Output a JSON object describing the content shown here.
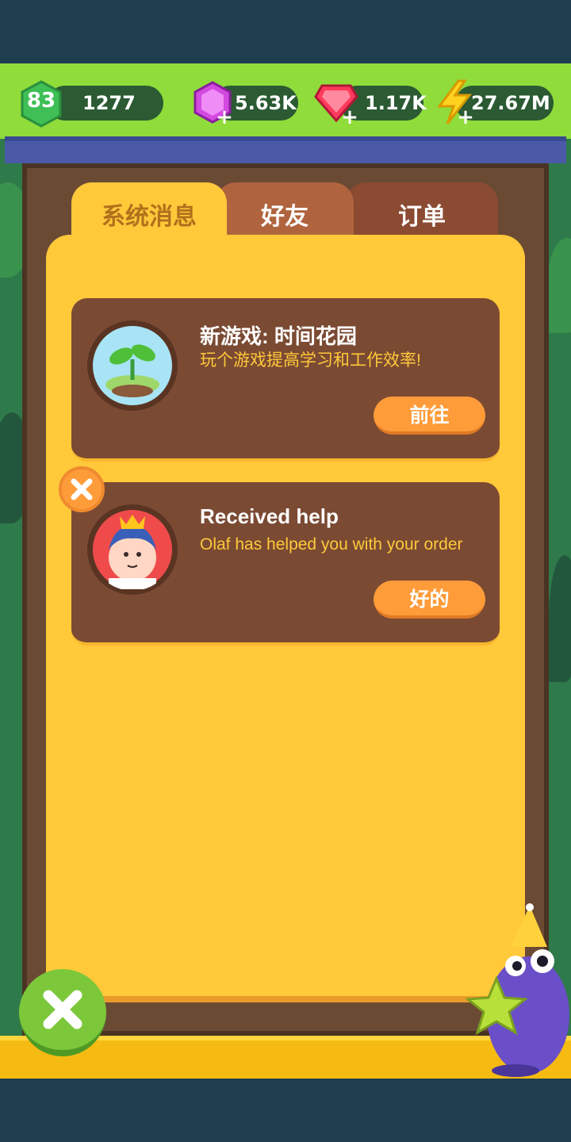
{
  "resources": {
    "level": "83",
    "xp": "1277",
    "purple_gems": "5.63K",
    "red_gems": "1.17K",
    "energy": "27.67M"
  },
  "tabs": [
    {
      "label": "系统消息",
      "active": true
    },
    {
      "label": "好友",
      "active": false
    },
    {
      "label": "订单",
      "active": false
    }
  ],
  "messages": [
    {
      "title": "新游戏: 时间花园",
      "subtitle": "玩个游戏提高学习和工作效率!",
      "button": "前往",
      "avatar_icon": "sprout-icon"
    },
    {
      "title": "Received help",
      "subtitle": "Olaf has helped you with your order",
      "button": "好的",
      "avatar_icon": "king-avatar-icon"
    }
  ],
  "colors": {
    "panel": "#ffc93a",
    "card": "#7b4a33",
    "button": "#ff9c3a",
    "close_button": "#7cc83a"
  }
}
